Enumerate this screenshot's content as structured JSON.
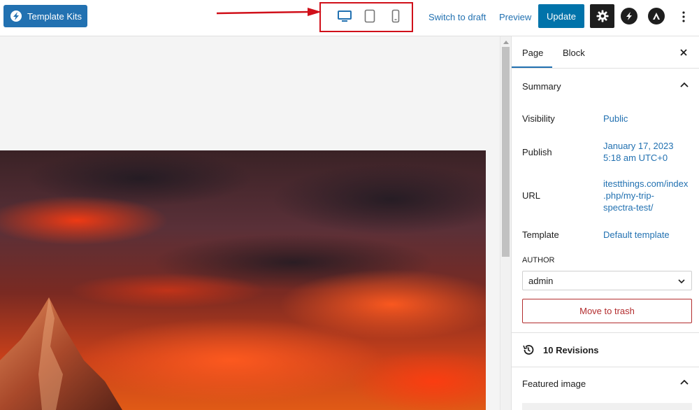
{
  "topbar": {
    "kits_label": "Template Kits",
    "switch_draft": "Switch to draft",
    "preview": "Preview",
    "update": "Update"
  },
  "sidebar": {
    "tabs": [
      "Page",
      "Block"
    ],
    "summary": {
      "title": "Summary",
      "visibility_label": "Visibility",
      "visibility_value": "Public",
      "publish_label": "Publish",
      "publish_date": "January 17, 2023",
      "publish_time": "5:18 am UTC+0",
      "url_label": "URL",
      "url_line1": "itestthings.com/index",
      "url_line2": ".php/my-trip-",
      "url_line3": "spectra-test/",
      "template_label": "Template",
      "template_value": "Default template",
      "author_label": "AUTHOR",
      "author_value": "admin",
      "trash": "Move to trash"
    },
    "revisions": "10 Revisions",
    "featured_image": "Featured image"
  },
  "colors": {
    "accent": "#2271b1",
    "update_bg": "#0073aa",
    "highlight_box": "#d0101a",
    "trash": "#b32d2e"
  }
}
